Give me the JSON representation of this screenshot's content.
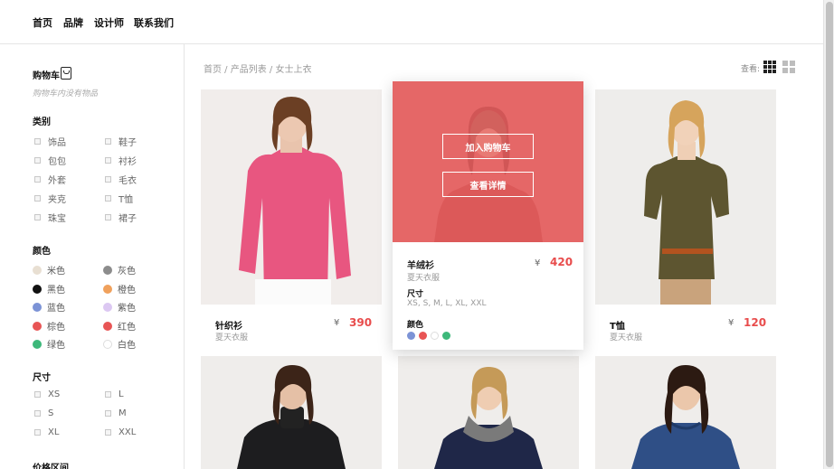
{
  "nav": {
    "items": [
      "首页",
      "品牌",
      "设计师",
      "联系我们"
    ]
  },
  "sidebar": {
    "cart_title": "购物车",
    "cart_empty": "购物车内没有物品",
    "category_title": "类别",
    "categories": [
      "饰品",
      "鞋子",
      "包包",
      "衬衫",
      "外套",
      "毛衣",
      "夹克",
      "T恤",
      "珠宝",
      "裙子"
    ],
    "color_title": "颜色",
    "colors": [
      {
        "label": "米色",
        "hex": "#e8dfd2"
      },
      {
        "label": "灰色",
        "hex": "#8c8c8c"
      },
      {
        "label": "黑色",
        "hex": "#111111"
      },
      {
        "label": "橙色",
        "hex": "#f0a15c"
      },
      {
        "label": "蓝色",
        "hex": "#7c93d6"
      },
      {
        "label": "紫色",
        "hex": "#dcc8f2"
      },
      {
        "label": "棕色",
        "hex": "#e85555"
      },
      {
        "label": "红色",
        "hex": "#e85555"
      },
      {
        "label": "绿色",
        "hex": "#3db87a"
      },
      {
        "label": "白色",
        "hex": "#ffffff"
      }
    ],
    "size_title": "尺寸",
    "sizes": [
      "XS",
      "L",
      "S",
      "M",
      "XL",
      "XXL"
    ],
    "price_title": "价格区间"
  },
  "breadcrumb": {
    "home": "首页",
    "sep1": " / ",
    "list": "产品列表",
    "sep2": " / ",
    "current": "女士上衣"
  },
  "view": {
    "label": "查看:"
  },
  "products": [
    {
      "name": "针织衫",
      "sub": "夏天衣服",
      "currency": "¥",
      "price": "390"
    },
    {
      "name": "T恤",
      "sub": "夏天衣服",
      "currency": "¥",
      "price": "120"
    }
  ],
  "active_product": {
    "add_to_cart": "加入购物车",
    "view_details": "查看详情",
    "name": "羊绒衫",
    "sub": "夏天衣服",
    "currency": "¥",
    "price": "420",
    "size_title": "尺寸",
    "sizes": "XS, S, M, L, XL, XXL",
    "color_title": "颜色",
    "colors": [
      "#7c93d6",
      "#e85555",
      "#ffffff",
      "#3db87a"
    ]
  },
  "theme": {
    "accent": "#e84c4c",
    "overlay": "#e35c5c"
  }
}
